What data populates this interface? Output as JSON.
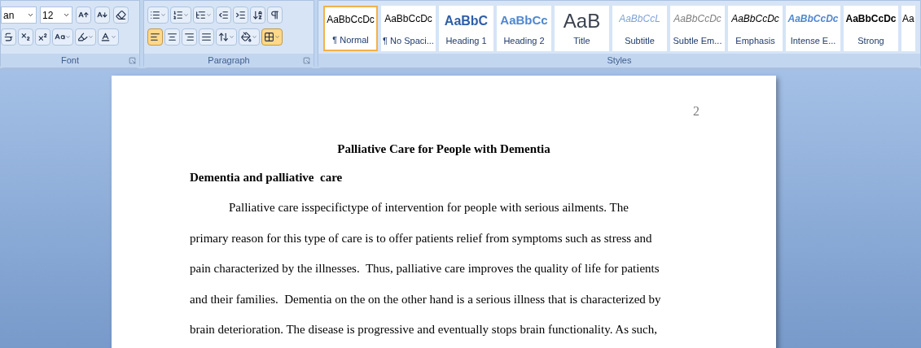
{
  "ribbon": {
    "font": {
      "label": "Font",
      "font_name": "an",
      "font_size": "12"
    },
    "paragraph": {
      "label": "Paragraph",
      "alignments": [
        {
          "kind": "left",
          "selected": true
        },
        {
          "kind": "center",
          "selected": false
        },
        {
          "kind": "right",
          "selected": false
        },
        {
          "kind": "justify",
          "selected": false
        }
      ],
      "borders_highlighted": true
    },
    "styles": {
      "label": "Styles",
      "items": [
        {
          "kind": "normal",
          "sample": "AaBbCcDc",
          "label": "¶ Normal",
          "selected": true
        },
        {
          "kind": "normal",
          "sample": "AaBbCcDc",
          "label": "¶ No Spaci...",
          "selected": false
        },
        {
          "kind": "heading1",
          "sample": "AaBbC",
          "label": "Heading 1",
          "selected": false
        },
        {
          "kind": "heading2",
          "sample": "AaBbCc",
          "label": "Heading 2",
          "selected": false
        },
        {
          "kind": "title",
          "sample": "AaB",
          "label": "Title",
          "selected": false
        },
        {
          "kind": "subtitle",
          "sample": "AaBbCcL",
          "label": "Subtitle",
          "selected": false
        },
        {
          "kind": "subtle",
          "sample": "AaBbCcDc",
          "label": "Subtle Em...",
          "selected": false
        },
        {
          "kind": "emphasis",
          "sample": "AaBbCcDc",
          "label": "Emphasis",
          "selected": false
        },
        {
          "kind": "intense",
          "sample": "AaBbCcDc",
          "label": "Intense E...",
          "selected": false
        },
        {
          "kind": "strong",
          "sample": "AaBbCcDc",
          "label": "Strong",
          "selected": false
        },
        {
          "kind": "normal",
          "sample": "Aa",
          "selected": false
        }
      ]
    }
  },
  "document": {
    "page_number": "2",
    "title": "Palliative Care for People with Dementia",
    "heading": "Dementia and palliative  care",
    "paragraph_lines": [
      "Palliative care isspecifictype of intervention for people with serious ailments. The",
      "primary reason for this type of care is to offer patients relief from symptoms such as stress and",
      "pain characterized by the illnesses.  Thus, palliative care improves the quality of life for patients",
      "and their families.  Dementia on the on the other hand is a serious illness that is characterized by",
      "brain deterioration. The disease is progressive and eventually stops brain functionality. As such,"
    ]
  }
}
